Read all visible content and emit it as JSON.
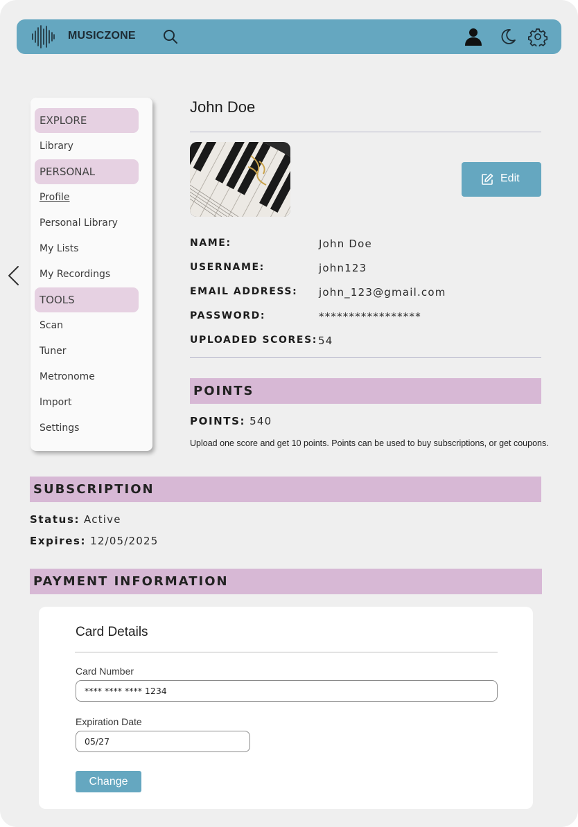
{
  "header": {
    "brand": "MUSICZONE",
    "icons": [
      "audio-wave-logo-icon",
      "search-icon",
      "user-icon",
      "moon-icon",
      "gear-icon"
    ]
  },
  "sidebar": {
    "items": [
      {
        "label": "EXPLORE",
        "type": "section"
      },
      {
        "label": "Library",
        "type": "link"
      },
      {
        "label": "PERSONAL",
        "type": "section"
      },
      {
        "label": "Profile",
        "type": "link",
        "active": true
      },
      {
        "label": "Personal Library",
        "type": "link"
      },
      {
        "label": "My Lists",
        "type": "link"
      },
      {
        "label": "My Recordings",
        "type": "link"
      },
      {
        "label": "TOOLS",
        "type": "section"
      },
      {
        "label": "Scan",
        "type": "link"
      },
      {
        "label": "Tuner",
        "type": "link"
      },
      {
        "label": "Metronome",
        "type": "link"
      },
      {
        "label": "Import",
        "type": "link"
      },
      {
        "label": "Settings",
        "type": "link"
      }
    ]
  },
  "profile": {
    "title": "John Doe",
    "edit_label": "Edit",
    "fields": [
      {
        "label": "NAME:",
        "value": "John Doe"
      },
      {
        "label": "USERNAME:",
        "value": "john123"
      },
      {
        "label": "EMAIL ADDRESS:",
        "value": "john_123@gmail.com"
      },
      {
        "label": "PASSWORD:",
        "value": "*****************"
      },
      {
        "label": "UPLOADED SCORES:",
        "value": "54"
      }
    ]
  },
  "points": {
    "heading": "POINTS",
    "label": "POINTS:",
    "value": "540",
    "description": "Upload one score and get 10 points. Points can be used to buy subscriptions, or get coupons."
  },
  "subscription": {
    "heading": "SUBSCRIPTION",
    "status_label": "Status:",
    "status_value": "Active",
    "expires_label": "Expires:",
    "expires_value": "12/05/2025"
  },
  "payment": {
    "heading": "PAYMENT INFORMATION",
    "card_title": "Card Details",
    "card_number_label": "Card Number",
    "card_number_value": "**** **** **** 1234",
    "expiration_label": "Expiration Date",
    "expiration_value": "05/27",
    "change_label": "Change"
  },
  "colors": {
    "topbar": "#65a7c0",
    "section_band": "#d7b8d5",
    "sidebar_section": "#e6d1e2",
    "page_bg": "#efefef"
  }
}
